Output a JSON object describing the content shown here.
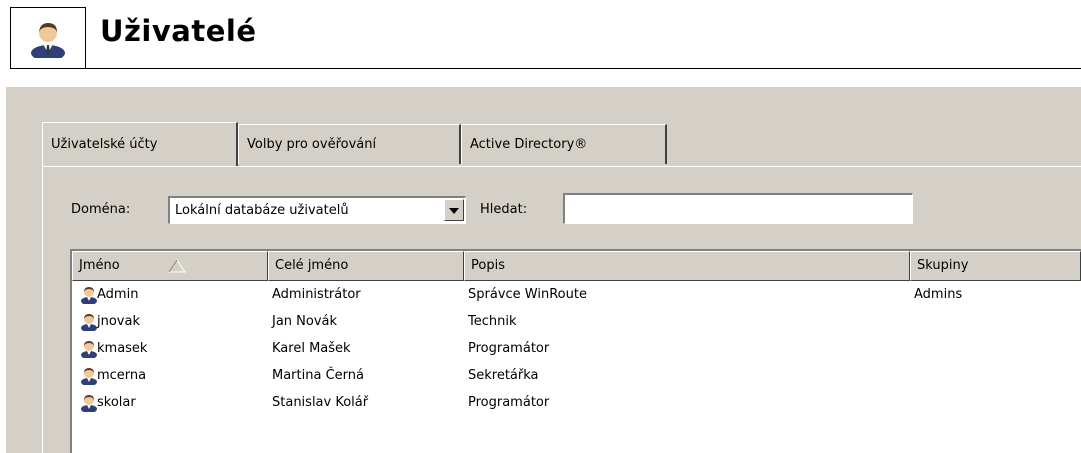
{
  "header": {
    "title": "Uživatelé",
    "icon": "user-icon"
  },
  "tabs": [
    {
      "label": "Uživatelské účty",
      "active": true
    },
    {
      "label": "Volby pro ověřování",
      "active": false
    },
    {
      "label": "Active Directory®",
      "active": false
    }
  ],
  "filter": {
    "domain_label": "Doména:",
    "domain_value": "Lokální databáze uživatelů",
    "search_label": "Hledat:",
    "search_value": ""
  },
  "table": {
    "columns": [
      "Jméno",
      "Celé jméno",
      "Popis",
      "Skupiny"
    ],
    "sort_column": "Jméno",
    "rows": [
      {
        "name": "Admin",
        "fullname": "Administrátor",
        "description": "Správce WinRoute",
        "groups": "Admins"
      },
      {
        "name": "jnovak",
        "fullname": "Jan Novák",
        "description": "Technik",
        "groups": ""
      },
      {
        "name": "kmasek",
        "fullname": "Karel Mašek",
        "description": "Programátor",
        "groups": ""
      },
      {
        "name": "mcerna",
        "fullname": "Martina Černá",
        "description": "Sekretářka",
        "groups": ""
      },
      {
        "name": "skolar",
        "fullname": "Stanislav Kolář",
        "description": "Programátor",
        "groups": ""
      }
    ]
  },
  "colors": {
    "window_bg": "#d4d0c8",
    "accent_blue": "#2a4f9a"
  }
}
